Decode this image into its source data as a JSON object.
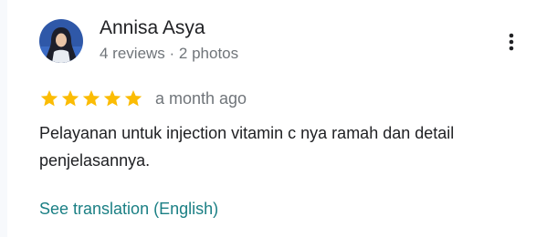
{
  "review": {
    "reviewer": {
      "name": "Annisa Asya",
      "meta": "4 reviews · 2 photos",
      "avatar_icon": "hijab-profile-photo"
    },
    "menu_icon": "more-vert-icon",
    "rating": {
      "stars": 5,
      "max_stars": 5,
      "star_color": "#fbbc04",
      "date": "a month ago"
    },
    "text": "Pelayanan untuk injection vitamin c nya ramah dan detail penjelasannya.",
    "translation_link": "See translation (English)"
  },
  "colors": {
    "name": "#202124",
    "secondary": "#70757a",
    "link": "#1a7f84",
    "background": "#ffffff"
  }
}
